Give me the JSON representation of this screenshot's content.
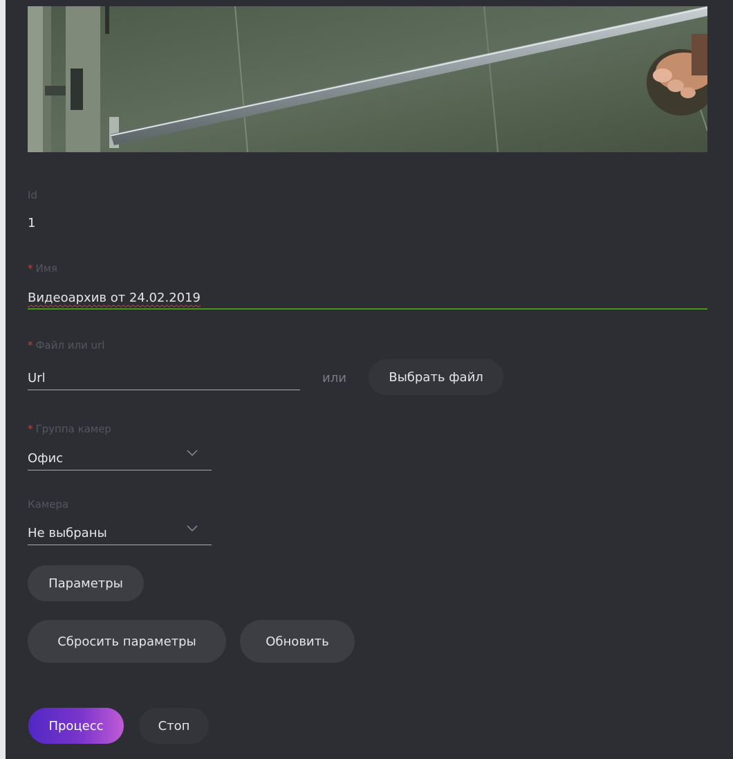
{
  "form": {
    "id": {
      "label": "Id",
      "value": "1"
    },
    "name": {
      "required_mark": "*",
      "label": "Имя",
      "value": "Видеоархив от 24.02.2019"
    },
    "file": {
      "required_mark": "*",
      "label": "Файл или url",
      "placeholder": "Url",
      "or_text": "или",
      "choose_button": "Выбрать файл"
    },
    "camera_group": {
      "required_mark": "*",
      "label": "Группа камер",
      "value": "Офис"
    },
    "camera": {
      "label": "Камера",
      "value": "Не выбраны"
    }
  },
  "buttons": {
    "params": "Параметры",
    "reset": "Сбросить параметры",
    "refresh": "Обновить",
    "process": "Процесс",
    "stop": "Стоп"
  },
  "colors": {
    "panel_bg": "#2d2e33",
    "accent_green": "#7fd13f",
    "required_red": "#d43b2f",
    "primary_gradient_start": "#5128c4",
    "primary_gradient_end": "#c05bd6"
  }
}
